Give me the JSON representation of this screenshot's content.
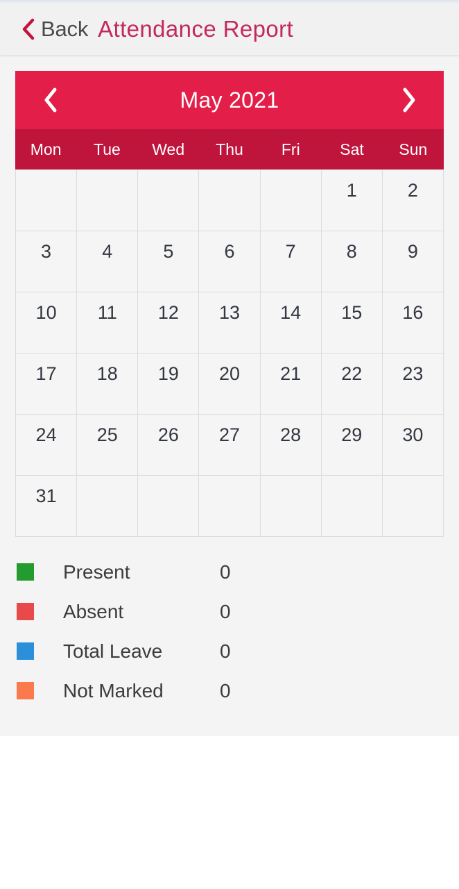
{
  "navbar": {
    "back_label": "Back",
    "back_icon": "chevron-left-icon",
    "title": "Attendance Report",
    "title_color": "#c3295a",
    "back_icon_color": "#c3143f"
  },
  "calendar": {
    "header": {
      "prev_icon": "chevron-left-icon",
      "next_icon": "chevron-right-icon",
      "month_year": "May 2021",
      "background_color": "#e31e48"
    },
    "weekday_header_color": "#bf143c",
    "weekdays": [
      "Mon",
      "Tue",
      "Wed",
      "Thu",
      "Fri",
      "Sat",
      "Sun"
    ],
    "weeks": [
      [
        "",
        "",
        "",
        "",
        "",
        "1",
        "2"
      ],
      [
        "3",
        "4",
        "5",
        "6",
        "7",
        "8",
        "9"
      ],
      [
        "10",
        "11",
        "12",
        "13",
        "14",
        "15",
        "16"
      ],
      [
        "17",
        "18",
        "19",
        "20",
        "21",
        "22",
        "23"
      ],
      [
        "24",
        "25",
        "26",
        "27",
        "28",
        "29",
        "30"
      ],
      [
        "31",
        "",
        "",
        "",
        "",
        "",
        ""
      ]
    ]
  },
  "legend": [
    {
      "label": "Present",
      "value": "0",
      "color": "#239b2f"
    },
    {
      "label": "Absent",
      "value": "0",
      "color": "#e8494a"
    },
    {
      "label": "Total Leave",
      "value": "0",
      "color": "#2b90d9"
    },
    {
      "label": "Not Marked",
      "value": "0",
      "color": "#fa7a4e"
    }
  ]
}
